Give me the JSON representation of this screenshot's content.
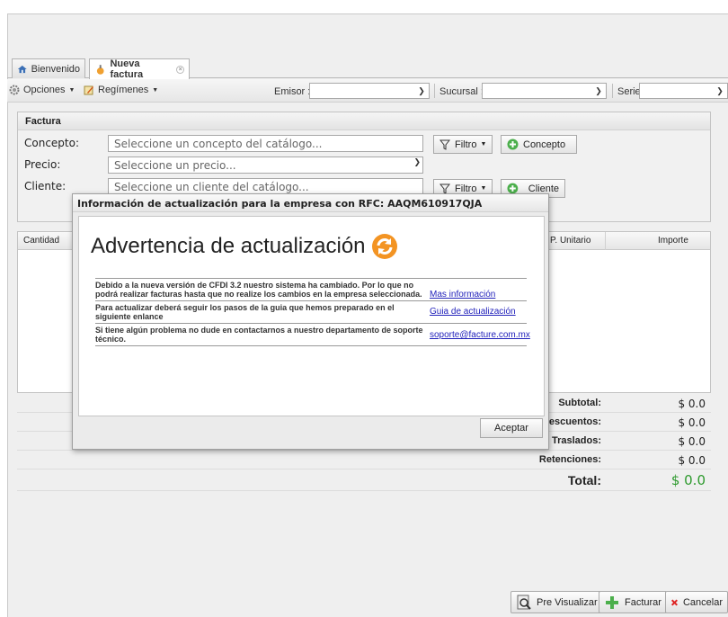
{
  "tabs": [
    {
      "label": "Bienvenido",
      "icon": "home-icon"
    },
    {
      "label": "Nueva factura",
      "icon": "invoice-icon"
    }
  ],
  "toolbar": {
    "opciones": "Opciones",
    "regimenes": "Regímenes",
    "emisor_label": "Emisor :",
    "sucursal_label": "Sucursal :",
    "serie_label": "Serie :"
  },
  "factura": {
    "title": "Factura",
    "concepto_label": "Concepto:",
    "concepto_placeholder": "Seleccione un concepto del catálogo...",
    "precio_label": "Precio:",
    "precio_placeholder": "Seleccione un precio...",
    "cliente_label": "Cliente:",
    "cliente_placeholder": "Seleccione un cliente del catálogo...",
    "filtro_label": "Filtro",
    "concepto_button": "Concepto",
    "cliente_button": "Cliente"
  },
  "grid": {
    "headers": [
      "Cantidad",
      "P. Unitario",
      "Importe"
    ]
  },
  "totals": [
    {
      "label": "Subtotal:",
      "value": "$ 0.0"
    },
    {
      "label": "Descuentos:",
      "value": "$ 0.0"
    },
    {
      "label": "Traslados:",
      "value": "$ 0.0"
    },
    {
      "label": "Retenciones:",
      "value": "$ 0.0"
    },
    {
      "label": "Total:",
      "value": "$ 0.0"
    }
  ],
  "bottom_buttons": {
    "preview": "Pre Visualizar",
    "facturar": "Facturar",
    "cancelar": "Cancelar"
  },
  "modal": {
    "title": "Información de actualización para la empresa con RFC: AAQM610917QJA",
    "heading": "Advertencia de actualización",
    "rows": [
      {
        "text": "Debido a la nueva versión de CFDI 3.2 nuestro sistema ha cambiado. Por lo que no podrá realizar facturas hasta que no realize los cambios en la empresa seleccionada.",
        "link": "Mas información"
      },
      {
        "text": "Para actualizar deberá seguir los pasos de la guia que hemos preparado en el siguiente enlance",
        "link": "Guia de actualización"
      },
      {
        "text": "Si tiene algún problema no dude en contactarnos a nuestro departamento de soporte técnico.",
        "link": "soporte@facture.com.mx"
      }
    ],
    "accept": "Aceptar"
  },
  "colors": {
    "total_green": "#2d9a2d",
    "link_blue": "#2222bb",
    "refresh_orange": "#f39423"
  }
}
